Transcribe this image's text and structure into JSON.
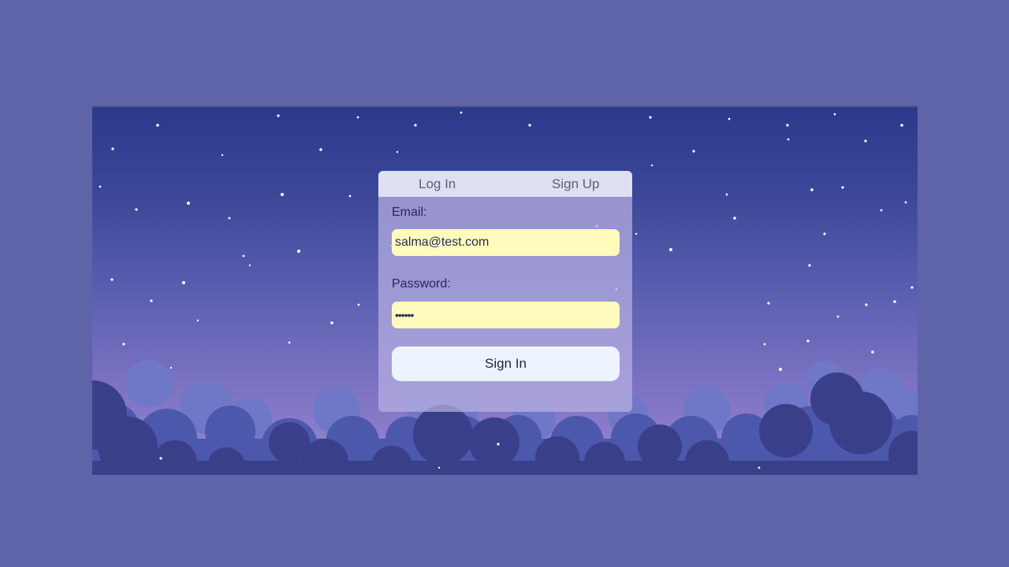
{
  "tabs": {
    "login_label": "Log In",
    "signup_label": "Sign Up"
  },
  "form": {
    "email_label": "Email:",
    "email_value": "salma@test.com",
    "password_label": "Password:",
    "password_value": "••••••",
    "submit_label": "Sign In"
  },
  "colors": {
    "page_background": "#5f63a8",
    "sky_top": "#2c3a8c",
    "sky_bottom": "#9a86d3",
    "input_background": "#fffbbc",
    "button_background": "#eef4ff"
  }
}
